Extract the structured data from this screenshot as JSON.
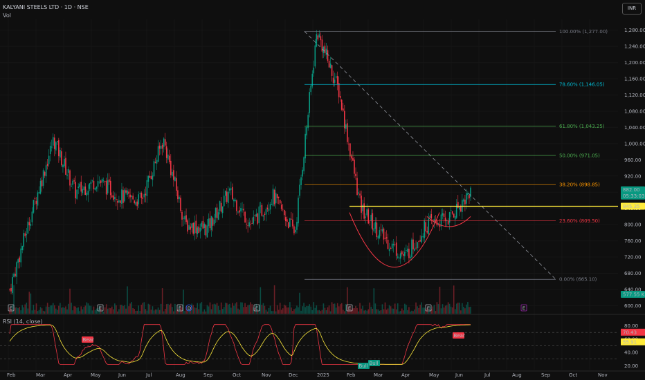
{
  "header": {
    "symbol_title": "KALYANI STEELS LTD · 1D · NSE",
    "vol_label": "Vol",
    "currency_button": "INR"
  },
  "rsi_panel": {
    "title": "RSI (14, close)",
    "scale": [
      80,
      60,
      40,
      20
    ],
    "scale_labels": [
      "80.00",
      "60.00",
      "40.00",
      "20.00"
    ],
    "value_badge": "70.43",
    "ma_badge": "55.91",
    "signals": [
      {
        "label": "Bear",
        "color": "#f23645"
      },
      {
        "label": "Bull",
        "color": "#089981"
      },
      {
        "label": "Bull",
        "color": "#089981"
      },
      {
        "label": "Bear",
        "color": "#f23645"
      }
    ]
  },
  "price_axis": {
    "ticks": [
      "1,280.00",
      "1,240.00",
      "1,200.00",
      "1,160.00",
      "1,120.00",
      "1,080.00",
      "1,040.00",
      "1,000.00",
      "960.00",
      "920.00",
      "880.00",
      "840.00",
      "800.00",
      "760.00",
      "720.00",
      "680.00",
      "640.00",
      "600.00"
    ],
    "tick_values": [
      1280,
      1240,
      1200,
      1160,
      1120,
      1080,
      1040,
      1000,
      960,
      920,
      880,
      840,
      800,
      760,
      720,
      680,
      640,
      600
    ],
    "last_price_badge": "882.00",
    "countdown_badge": "05:33:03",
    "level_badge": "845.35",
    "volume_badge": "577.55 K"
  },
  "time_axis": {
    "labels": [
      "Feb",
      "Mar",
      "Apr",
      "May",
      "Jun",
      "Jul",
      "Aug",
      "Sep",
      "Oct",
      "Nov",
      "Dec",
      "2025",
      "Feb",
      "Mar",
      "Apr",
      "May",
      "Jun",
      "Jul",
      "Aug",
      "Sep",
      "Oct",
      "Nov"
    ]
  },
  "fibonacci": [
    {
      "label": "100.00% (1,277.00)",
      "price": 1277.0,
      "color": "#787b86"
    },
    {
      "label": "78.60% (1,146.05)",
      "price": 1146.05,
      "color": "#00bcd4"
    },
    {
      "label": "61.80% (1,043.25)",
      "price": 1043.25,
      "color": "#4caf50"
    },
    {
      "label": "50.00% (971.05)",
      "price": 971.05,
      "color": "#4caf50"
    },
    {
      "label": "38.20% (898.85)",
      "price": 898.85,
      "color": "#ff9800"
    },
    {
      "label": "23.60% (809.50)",
      "price": 809.5,
      "color": "#f23645"
    },
    {
      "label": "0.00% (665.10)",
      "price": 665.1,
      "color": "#787b86"
    }
  ],
  "horizontal_level": {
    "price": 845.35,
    "color": "#ffeb3b"
  },
  "chart_data": {
    "type": "candlestick",
    "symbol": "KALYANI STEELS LTD",
    "interval": "1D",
    "exchange": "NSE",
    "ylim": [
      600,
      1300
    ],
    "last_close": 882.0,
    "x_months": [
      "Feb 2024",
      "Mar",
      "Apr",
      "May",
      "Jun",
      "Jul",
      "Aug",
      "Sep",
      "Oct",
      "Nov",
      "Dec",
      "Jan 2025",
      "Feb",
      "Mar",
      "Apr",
      "May",
      "Jun"
    ],
    "approx_close_path": [
      {
        "x": "Feb 2024 start",
        "y": 640
      },
      {
        "x": "Feb 2024 late",
        "y": 830
      },
      {
        "x": "Mar 2024 early",
        "y": 1010
      },
      {
        "x": "Mar 2024",
        "y": 880
      },
      {
        "x": "Apr 2024",
        "y": 910
      },
      {
        "x": "May 2024",
        "y": 870
      },
      {
        "x": "Jun 2024",
        "y": 860
      },
      {
        "x": "Jul 2024",
        "y": 1010
      },
      {
        "x": "Aug 2024",
        "y": 800
      },
      {
        "x": "Sep 2024",
        "y": 790
      },
      {
        "x": "Oct 2024",
        "y": 880
      },
      {
        "x": "Oct 2024 late",
        "y": 800
      },
      {
        "x": "Nov 2024",
        "y": 870
      },
      {
        "x": "Nov 2024 late",
        "y": 780
      },
      {
        "x": "Dec 2024",
        "y": 1277
      },
      {
        "x": "Jan 2025",
        "y": 1130
      },
      {
        "x": "Feb 2025",
        "y": 840
      },
      {
        "x": "Mar 2025",
        "y": 770
      },
      {
        "x": "Apr 2025",
        "y": 720
      },
      {
        "x": "May 2025",
        "y": 800
      },
      {
        "x": "Jun 2025",
        "y": 815
      },
      {
        "x": "Jun 2025 last",
        "y": 882
      }
    ],
    "rsi": {
      "last": 70.43,
      "ma_last": 55.91,
      "levels": [
        70,
        50,
        30
      ]
    }
  },
  "event_markers": [
    "E",
    "E",
    "E",
    "D",
    "E",
    "E",
    "E",
    "E"
  ]
}
